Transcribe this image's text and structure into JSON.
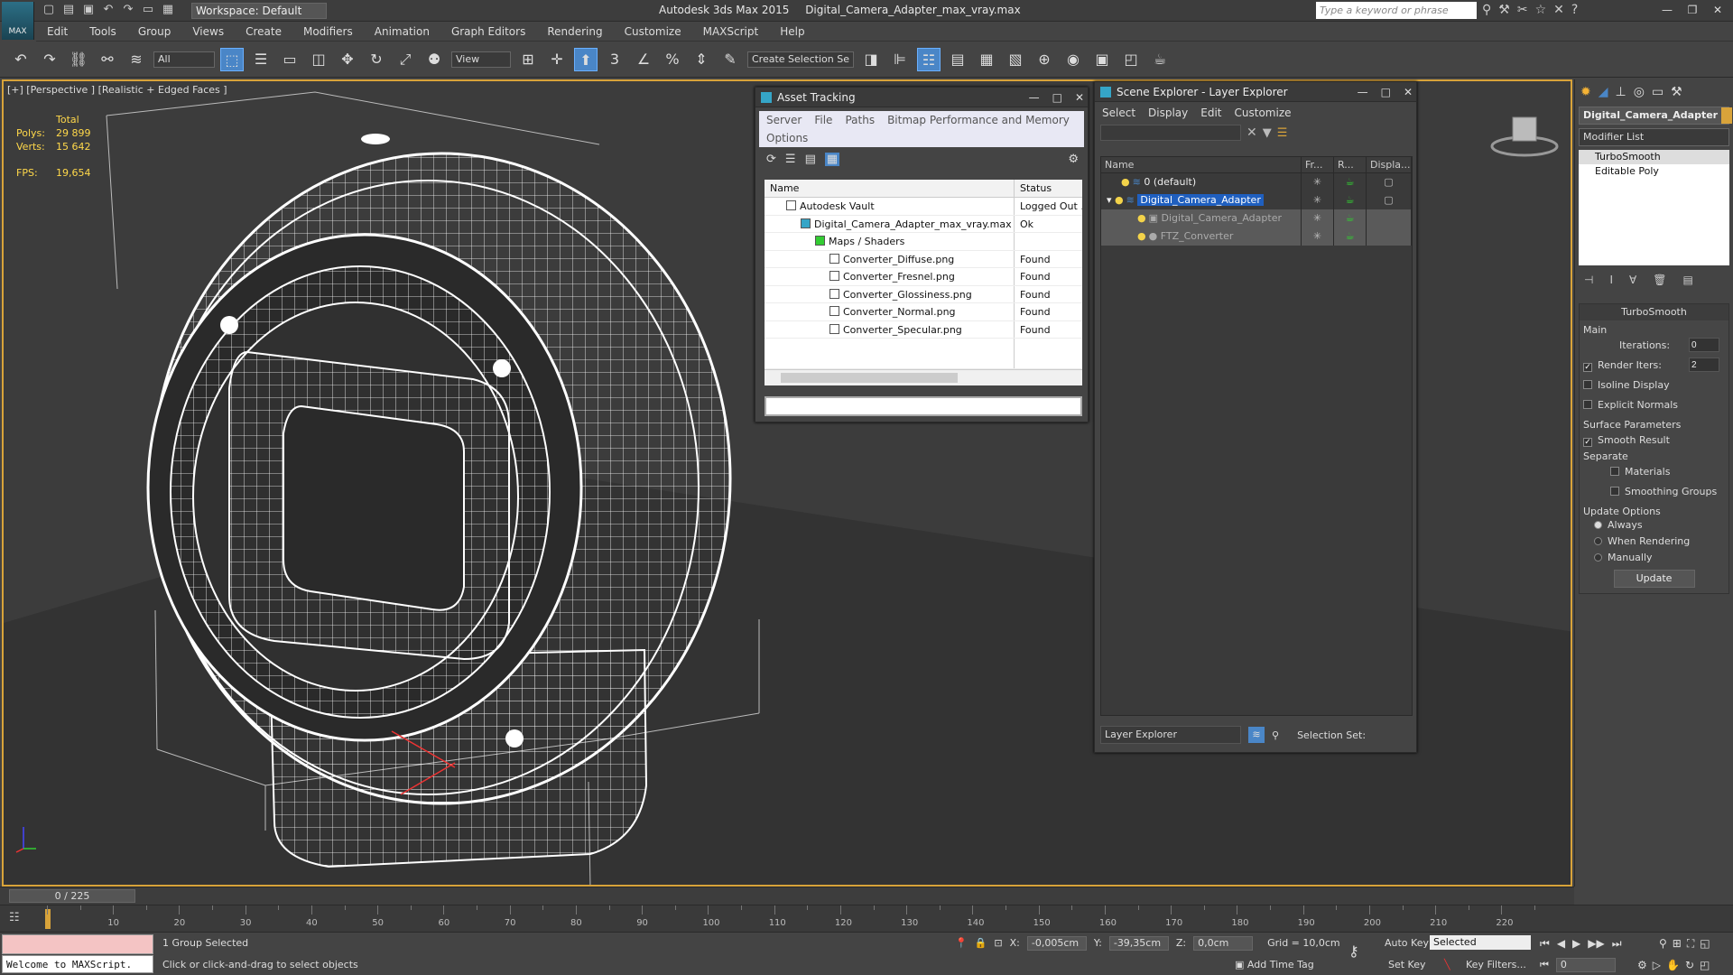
{
  "app": {
    "logo": "MAX",
    "workspace": "Workspace: Default",
    "product": "Autodesk 3ds Max  2015",
    "file": "Digital_Camera_Adapter_max_vray.max",
    "search_placeholder": "Type a keyword or phrase"
  },
  "menu": [
    "Edit",
    "Tools",
    "Group",
    "Views",
    "Create",
    "Modifiers",
    "Animation",
    "Graph Editors",
    "Rendering",
    "Customize",
    "MAXScript",
    "Help"
  ],
  "toolbar": {
    "filter": "All",
    "ref_coord": "View",
    "selection_set": "Create Selection Se"
  },
  "viewport": {
    "label": "[+] [Perspective ] [Realistic + Edged Faces ]",
    "stats_header": "Total",
    "polys_label": "Polys:",
    "polys": "29 899",
    "verts_label": "Verts:",
    "verts": "15 642",
    "fps_label": "FPS:",
    "fps": "19,654"
  },
  "asset_tracking": {
    "title": "Asset Tracking",
    "menu": [
      "Server",
      "File",
      "Paths",
      "Bitmap Performance and Memory"
    ],
    "menu2": "Options",
    "col_name": "Name",
    "col_status": "Status",
    "rows": [
      {
        "name": "Autodesk Vault",
        "status": "Logged Out ...",
        "indent": 1
      },
      {
        "name": "Digital_Camera_Adapter_max_vray.max",
        "status": "Ok",
        "indent": 2
      },
      {
        "name": "Maps / Shaders",
        "status": "",
        "indent": 3
      },
      {
        "name": "Converter_Diffuse.png",
        "status": "Found",
        "indent": 4
      },
      {
        "name": "Converter_Fresnel.png",
        "status": "Found",
        "indent": 4
      },
      {
        "name": "Converter_Glossiness.png",
        "status": "Found",
        "indent": 4
      },
      {
        "name": "Converter_Normal.png",
        "status": "Found",
        "indent": 4
      },
      {
        "name": "Converter_Specular.png",
        "status": "Found",
        "indent": 4
      }
    ]
  },
  "scene_explorer": {
    "title": "Scene Explorer - Layer Explorer",
    "menu": [
      "Select",
      "Display",
      "Edit",
      "Customize"
    ],
    "cols": [
      "Name",
      "Fr...",
      "R...",
      "Displa..."
    ],
    "rows": [
      {
        "name": "0 (default)",
        "state": "normal",
        "indent": 1
      },
      {
        "name": "Digital_Camera_Adapter",
        "state": "selected",
        "indent": 1
      },
      {
        "name": "Digital_Camera_Adapter",
        "state": "dim",
        "indent": 2
      },
      {
        "name": "FTZ_Converter",
        "state": "dim",
        "indent": 2
      }
    ],
    "footer_mode": "Layer Explorer",
    "footer_set": "Selection Set:"
  },
  "command_panel": {
    "object_name": "Digital_Camera_Adapter",
    "modifier_list": "Modifier List",
    "stack": [
      "TurboSmooth",
      "Editable Poly"
    ],
    "rollout_title": "TurboSmooth",
    "main_label": "Main",
    "iterations_label": "Iterations:",
    "iterations": "0",
    "render_iters_label": "Render Iters:",
    "render_iters": "2",
    "isoline": "Isoline Display",
    "explicit_normals": "Explicit Normals",
    "surface_params": "Surface Parameters",
    "smooth_result": "Smooth Result",
    "separate": "Separate",
    "materials": "Materials",
    "smoothing_groups": "Smoothing Groups",
    "update_options": "Update Options",
    "always": "Always",
    "when_rendering": "When Rendering",
    "manually": "Manually",
    "update_btn": "Update"
  },
  "timeline": {
    "frame": "0 / 225",
    "ticks": [
      "10",
      "20",
      "30",
      "40",
      "50",
      "60",
      "70",
      "80",
      "90",
      "100",
      "110",
      "120",
      "130",
      "140",
      "150",
      "160",
      "170",
      "180",
      "190",
      "200",
      "210",
      "220"
    ]
  },
  "status": {
    "script_output": "Welcome to MAXScript.",
    "selection": "1 Group Selected",
    "prompt": "Click or click-and-drag to select objects",
    "x_label": "X:",
    "x": "-0,005cm",
    "y_label": "Y:",
    "y": "-39,35cm",
    "z_label": "Z:",
    "z": "0,0cm",
    "grid": "Grid = 10,0cm",
    "add_time_tag": "Add Time Tag",
    "auto_key": "Auto Key",
    "key_mode": "Selected",
    "set_key": "Set Key",
    "key_filters": "Key Filters...",
    "current_frame": "0"
  }
}
